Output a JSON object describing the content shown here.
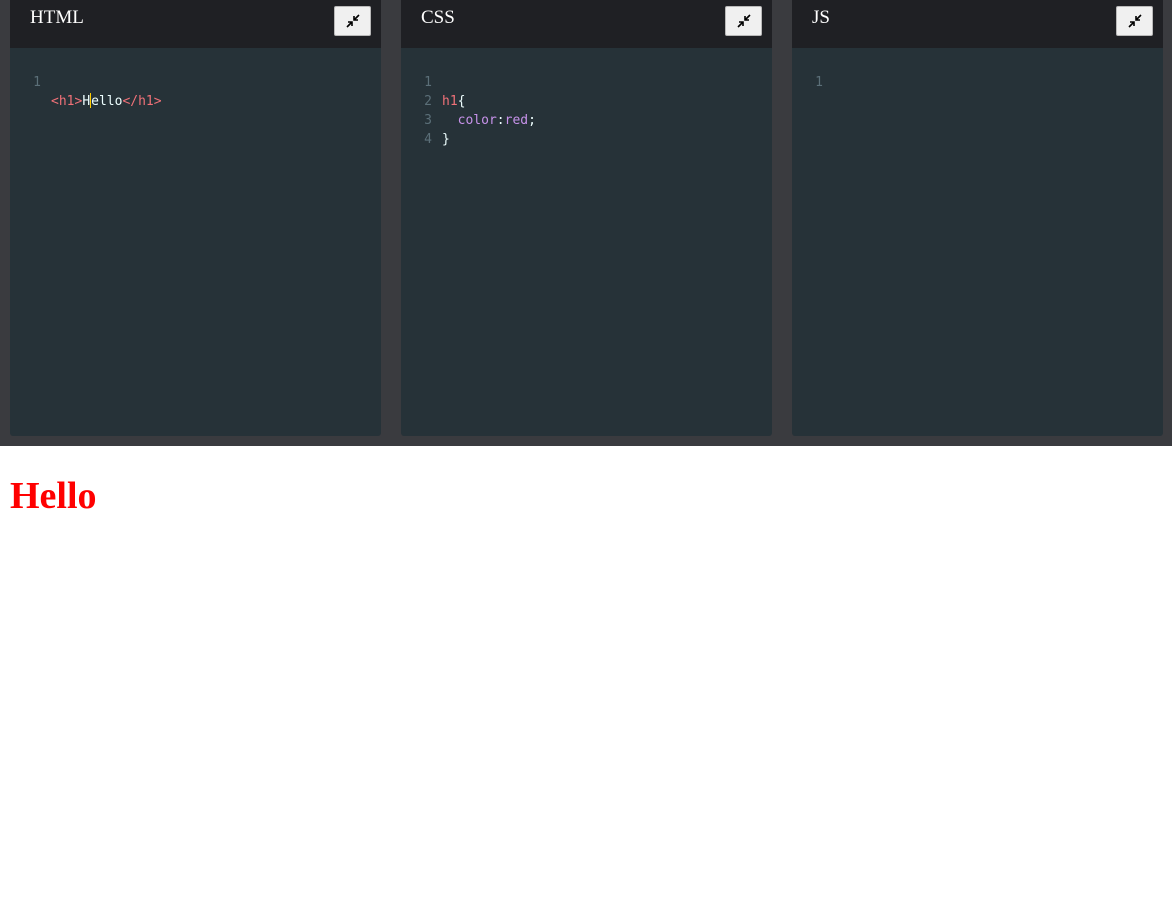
{
  "panels": {
    "html": {
      "title": "HTML",
      "lines": [
        {
          "num": "1",
          "tokens": {
            "open": "<h1>",
            "text_before_cursor": "H",
            "text_after_cursor": "ello",
            "close": "</h1>"
          }
        }
      ]
    },
    "css": {
      "title": "CSS",
      "lines": [
        {
          "num": "1",
          "selector": "h1",
          "brace": "{"
        },
        {
          "num": "2",
          "indent": "  ",
          "prop": "color",
          "colon": ":",
          "value": "red",
          "semi": ";"
        },
        {
          "num": "3",
          "brace": "}"
        },
        {
          "num": "4"
        }
      ]
    },
    "js": {
      "title": "JS",
      "lines": [
        {
          "num": "1"
        }
      ]
    }
  },
  "icons": {
    "collapse": "collapse-arrows-icon"
  },
  "preview": {
    "heading": "Hello",
    "heading_color": "#ff0000"
  },
  "colors": {
    "editor_bg": "#263238",
    "header_bg": "#1f2024",
    "strip_bg": "#3a3b3f",
    "tag": "#f07178",
    "property": "#c792ea",
    "line_number": "#5b6f78"
  }
}
